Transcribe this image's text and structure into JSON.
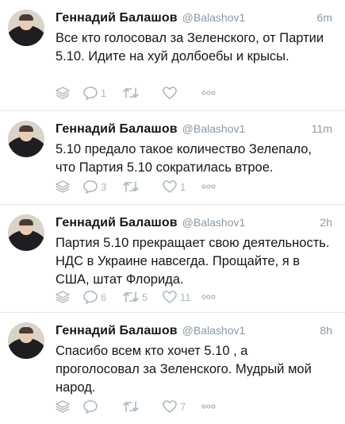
{
  "tweets": [
    {
      "author": "Геннадий Балашов",
      "handle": "@Balashov1",
      "time": "6m",
      "text": "Все кто голосовал за Зеленского, от Партии 5.10. Идите на хуй долбоебы и крысы.",
      "replies": "1",
      "retweets": "",
      "likes": ""
    },
    {
      "author": "Геннадий Балашов",
      "handle": "@Balashov1",
      "time": "11m",
      "text": "5.10 предало такое количество Зелепало, что  Партия 5.10 сократилась втрое.",
      "replies": "3",
      "retweets": "",
      "likes": "1"
    },
    {
      "author": "Геннадий Балашов",
      "handle": "@Balashov1",
      "time": "2h",
      "text": "Партия 5.10 прекращает свою деятельность.  НДС в Украине навсегда. Прощайте, я в США, штат Флорида.",
      "replies": "6",
      "retweets": "5",
      "likes": "11"
    },
    {
      "author": "Геннадий Балашов",
      "handle": "@Balashov1",
      "time": "8h",
      "text": "Спасибо всем кто хочет 5.10 , а проголосовал за Зеленского. Мудрый мой народ.",
      "replies": "",
      "retweets": "",
      "likes": "7"
    }
  ],
  "icons": {
    "analytics": "analytics-icon",
    "reply": "reply-icon",
    "retweet": "retweet-icon",
    "like": "heart-icon",
    "more": "more-icon"
  },
  "colors": {
    "text": "#14171a",
    "muted": "#8899a6",
    "icon": "#aab8c2",
    "divider": "#e1e8ed"
  }
}
